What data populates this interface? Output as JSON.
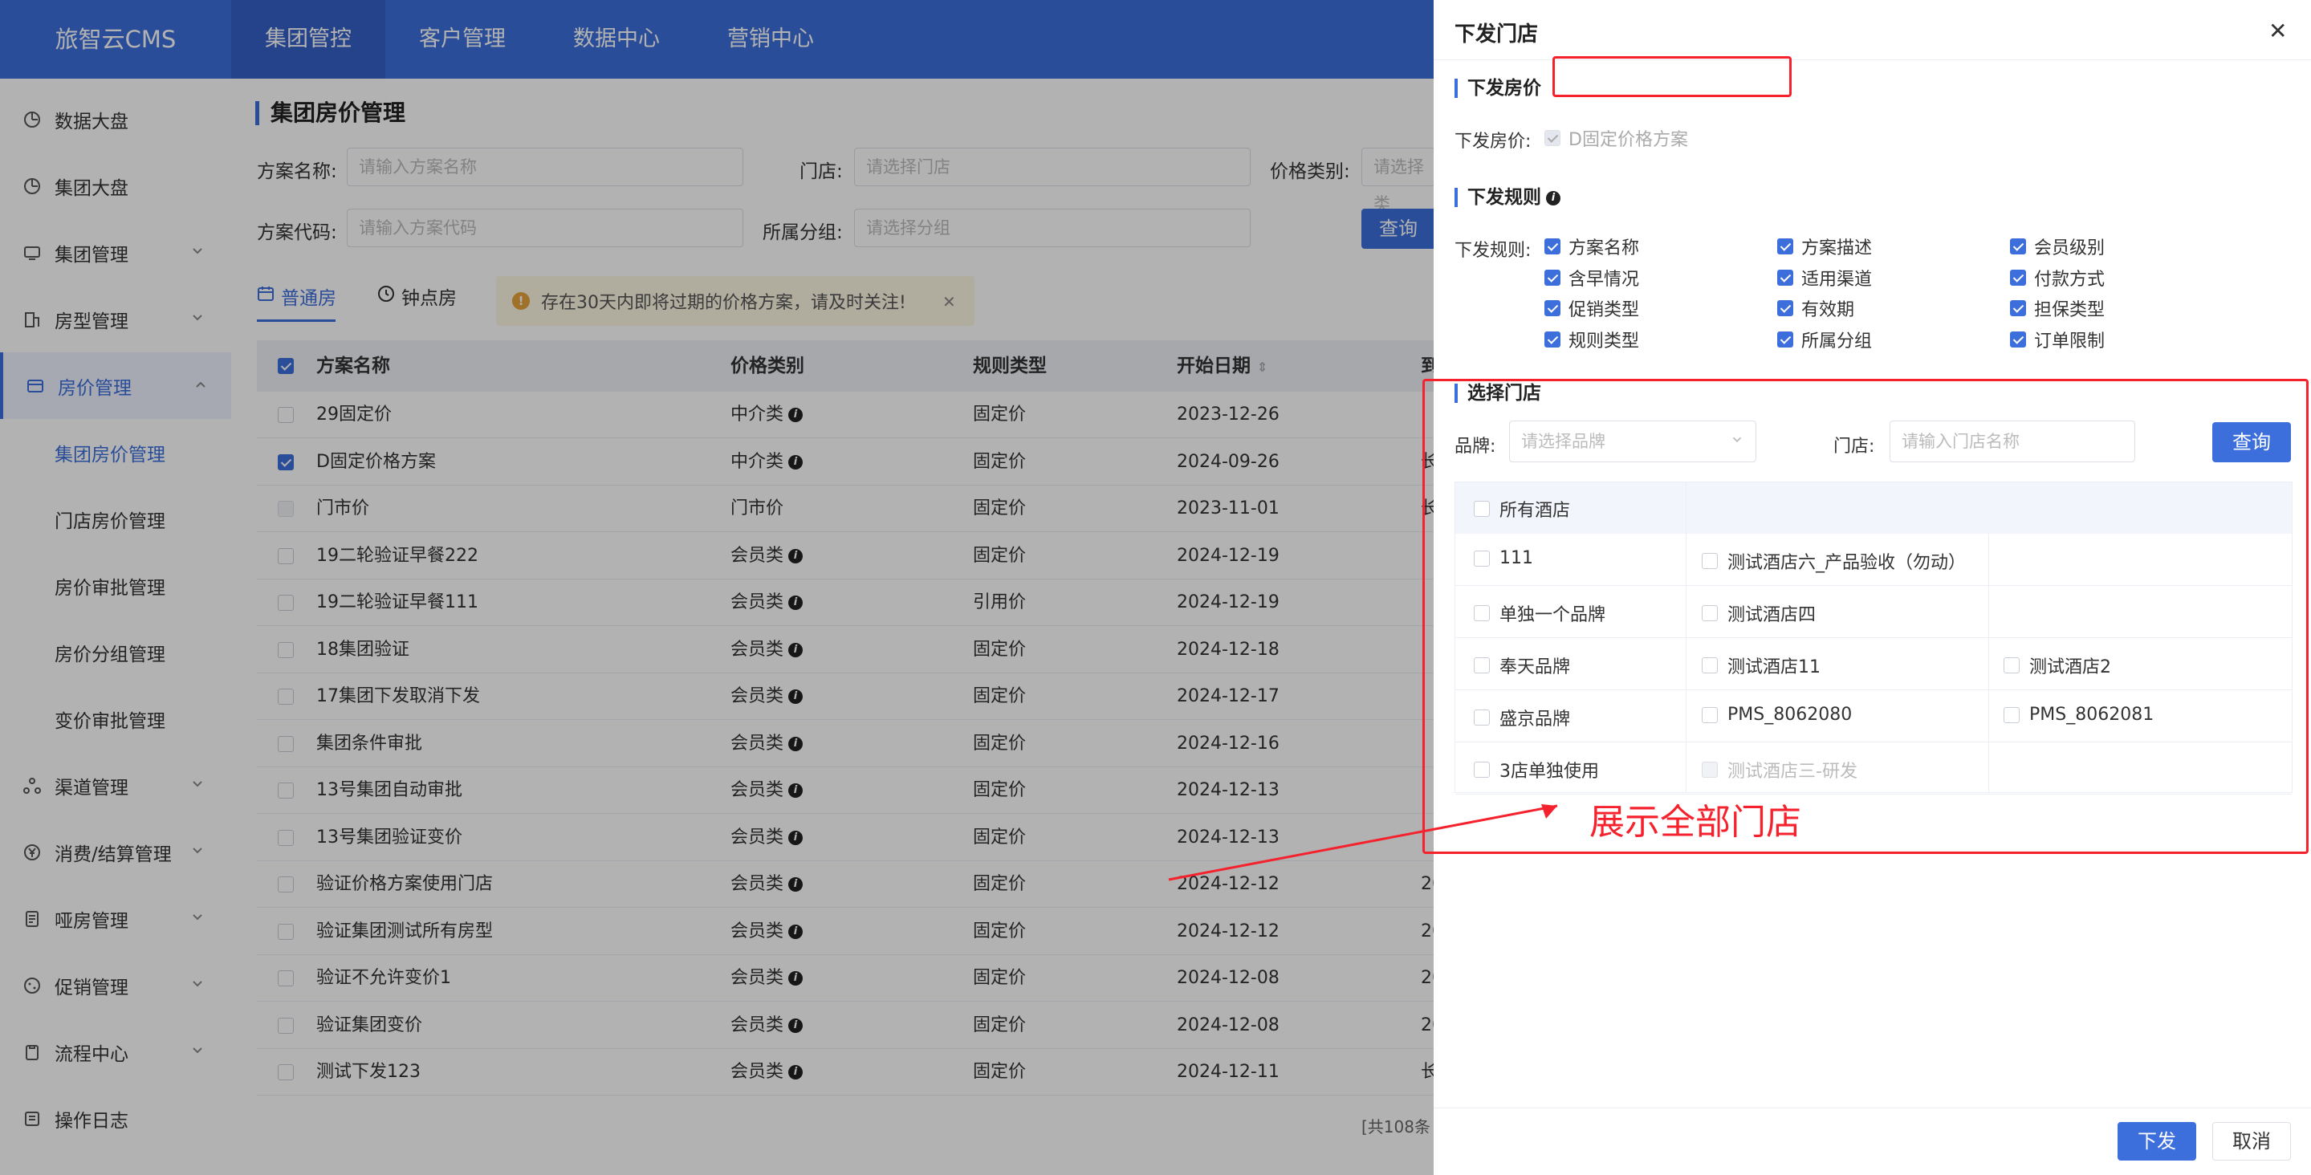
{
  "app": {
    "logo": "旅智云CMS"
  },
  "topnav": [
    "集团管控",
    "客户管理",
    "数据中心",
    "营销中心"
  ],
  "sidebar": {
    "items": [
      {
        "label": "数据大盘",
        "icon": "dashboard-icon"
      },
      {
        "label": "集团大盘",
        "icon": "dashboard-icon"
      },
      {
        "label": "集团管理",
        "icon": "monitor-icon"
      },
      {
        "label": "房型管理",
        "icon": "building-icon"
      },
      {
        "label": "房价管理",
        "icon": "room-price-icon"
      },
      {
        "label": "集团房价管理"
      },
      {
        "label": "门店房价管理"
      },
      {
        "label": "房价审批管理"
      },
      {
        "label": "房价分组管理"
      },
      {
        "label": "变价审批管理"
      },
      {
        "label": "渠道管理",
        "icon": "channel-icon"
      },
      {
        "label": "消费/结算管理",
        "icon": "yen-icon"
      },
      {
        "label": "哑房管理",
        "icon": "document-icon"
      },
      {
        "label": "促销管理",
        "icon": "promotion-icon"
      },
      {
        "label": "流程中心",
        "icon": "clipboard-icon"
      },
      {
        "label": "操作日志",
        "icon": "log-icon"
      }
    ]
  },
  "page": {
    "title": "集团房价管理",
    "filters": {
      "plan_name_label": "方案名称:",
      "plan_name_placeholder": "请输入方案名称",
      "store_label": "门店:",
      "store_placeholder": "请选择门店",
      "price_type_label": "价格类别:",
      "price_type_placeholder": "请选择类",
      "plan_code_label": "方案代码:",
      "plan_code_placeholder": "请输入方案代码",
      "group_label": "所属分组:",
      "group_placeholder": "请选择分组",
      "query": "查询"
    },
    "tabs": [
      "普通房",
      "钟点房"
    ],
    "alert": "存在30天内即将过期的价格方案，请及时关注!",
    "columns": [
      "方案名称",
      "价格类别",
      "规则类型",
      "开始日期",
      "到"
    ],
    "rows": [
      {
        "name": "29固定价",
        "cat": "中介类",
        "rule": "固定价",
        "start": "2023-12-26",
        "end": ""
      },
      {
        "name": "D固定价格方案",
        "cat": "中介类",
        "rule": "固定价",
        "start": "2024-09-26",
        "end": "长"
      },
      {
        "name": "门市价",
        "cat": "门市价",
        "rule": "固定价",
        "start": "2023-11-01",
        "end": "长"
      },
      {
        "name": "19二轮验证早餐222",
        "cat": "会员类",
        "rule": "固定价",
        "start": "2024-12-19",
        "end": ""
      },
      {
        "name": "19二轮验证早餐111",
        "cat": "会员类",
        "rule": "引用价",
        "start": "2024-12-19",
        "end": ""
      },
      {
        "name": "18集团验证",
        "cat": "会员类",
        "rule": "固定价",
        "start": "2024-12-18",
        "end": ""
      },
      {
        "name": "17集团下发取消下发",
        "cat": "会员类",
        "rule": "固定价",
        "start": "2024-12-17",
        "end": ""
      },
      {
        "name": "集团条件审批",
        "cat": "会员类",
        "rule": "固定价",
        "start": "2024-12-16",
        "end": ""
      },
      {
        "name": "13号集团自动审批",
        "cat": "会员类",
        "rule": "固定价",
        "start": "2024-12-13",
        "end": ""
      },
      {
        "name": "13号集团验证变价",
        "cat": "会员类",
        "rule": "固定价",
        "start": "2024-12-13",
        "end": ""
      },
      {
        "name": "验证价格方案使用门店",
        "cat": "会员类",
        "rule": "固定价",
        "start": "2024-12-12",
        "end": "20"
      },
      {
        "name": "验证集团测试所有房型",
        "cat": "会员类",
        "rule": "固定价",
        "start": "2024-12-12",
        "end": "20"
      },
      {
        "name": "验证不允许变价1",
        "cat": "会员类",
        "rule": "固定价",
        "start": "2024-12-08",
        "end": "20"
      },
      {
        "name": "验证集团变价",
        "cat": "会员类",
        "rule": "固定价",
        "start": "2024-12-08",
        "end": "20"
      },
      {
        "name": "测试下发123",
        "cat": "会员类",
        "rule": "固定价",
        "start": "2024-12-11",
        "end": "长"
      }
    ],
    "footer": "[共108条 "
  },
  "drawer": {
    "title": "下发门店",
    "section_price": "下发房价",
    "price_label": "下发房价:",
    "price_value": "D固定价格方案",
    "section_rules": "下发规则",
    "rules_label": "下发规则:",
    "rules": [
      [
        "方案名称",
        "方案描述",
        "会员级别"
      ],
      [
        "含早情况",
        "适用渠道",
        "付款方式"
      ],
      [
        "促销类型",
        "有效期",
        "担保类型"
      ],
      [
        "规则类型",
        "所属分组",
        "订单限制"
      ]
    ],
    "section_store": "选择门店",
    "brand_label": "品牌:",
    "brand_placeholder": "请选择品牌",
    "store_label": "门店:",
    "store_placeholder": "请输入门店名称",
    "query": "查询",
    "all_hotels": "所有酒店",
    "brands": [
      {
        "brand": "111",
        "stores": [
          "测试酒店六_产品验收（勿动）"
        ]
      },
      {
        "brand": "单独一个品牌",
        "stores": [
          "测试酒店四"
        ]
      },
      {
        "brand": "奉天品牌",
        "stores": [
          "测试酒店11",
          "测试酒店2"
        ]
      },
      {
        "brand": "盛京品牌",
        "stores": [
          "PMS_8062080",
          "PMS_8062081"
        ]
      },
      {
        "brand": "3店单独使用",
        "stores": [
          "测试酒店三-研发"
        ]
      }
    ],
    "submit": "下发",
    "cancel": "取消"
  },
  "annotation": "展示全部门店",
  "colors": {
    "primary": "#3d6fdc",
    "annotation": "#f5222d"
  }
}
